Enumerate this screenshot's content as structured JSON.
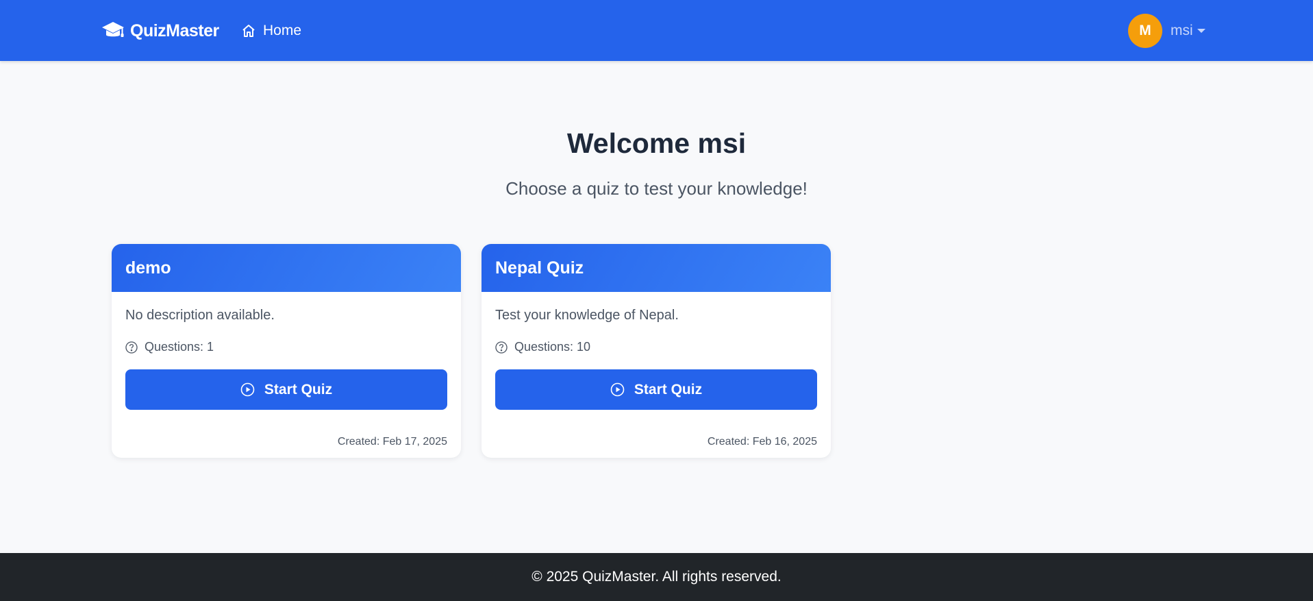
{
  "brand": {
    "name": "QuizMaster",
    "icon": "graduation-cap-icon"
  },
  "nav": {
    "home_label": "Home",
    "home_icon": "home-icon"
  },
  "user": {
    "initial": "M",
    "name": "msi",
    "avatar_color": "#f59e0b"
  },
  "hero": {
    "title": "Welcome msi",
    "subtitle": "Choose a quiz to test your knowledge!"
  },
  "quizzes": [
    {
      "title": "demo",
      "description": "No description available.",
      "questions_label": "Questions: 1",
      "button_label": "Start Quiz",
      "created_label": "Created: Feb 17, 2025"
    },
    {
      "title": "Nepal Quiz",
      "description": "Test your knowledge of Nepal.",
      "questions_label": "Questions: 10",
      "button_label": "Start Quiz",
      "created_label": "Created: Feb 16, 2025"
    }
  ],
  "footer": {
    "text": "© 2025 QuizMaster. All rights reserved."
  },
  "colors": {
    "primary": "#2563eb",
    "navbar": "#2563eb",
    "footer": "#212529",
    "page_background": "#f8f9fb"
  }
}
